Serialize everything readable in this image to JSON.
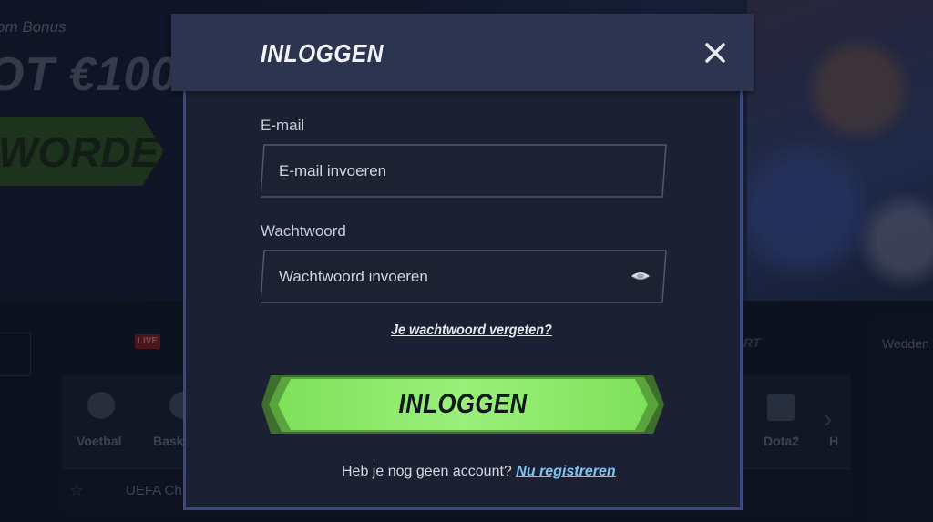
{
  "background": {
    "bonus_small": "om Bonus",
    "bonus_big": "OT €100",
    "cta_label": "WORDEN",
    "live_badge": "LIVE",
    "sports": [
      {
        "label": "Voetbal"
      },
      {
        "label": "Bask"
      },
      {
        "label": "Dota2"
      },
      {
        "label": "H"
      }
    ],
    "sport_right_fragment": "RT",
    "right_panel_label": "Wedden",
    "competition_row": "UEFA Ch"
  },
  "modal": {
    "title": "INLOGGEN",
    "close_icon": "close-icon",
    "email": {
      "label": "E-mail",
      "placeholder": "E-mail invoeren",
      "value": ""
    },
    "password": {
      "label": "Wachtwoord",
      "placeholder": "Wachtwoord invoeren",
      "value": "",
      "toggle_icon": "eye-icon"
    },
    "forgot_password": "Je wachtwoord vergeten?",
    "submit_label": "INLOGGEN",
    "no_account_text": "Heb je nog geen account?",
    "register_link": "Nu registreren",
    "colors": {
      "accent_green": "#86ea5e",
      "link_blue": "#7dc4f2",
      "header_bg": "#2c3450",
      "body_bg": "#1b2133",
      "border_blue": "#3a4884"
    }
  }
}
